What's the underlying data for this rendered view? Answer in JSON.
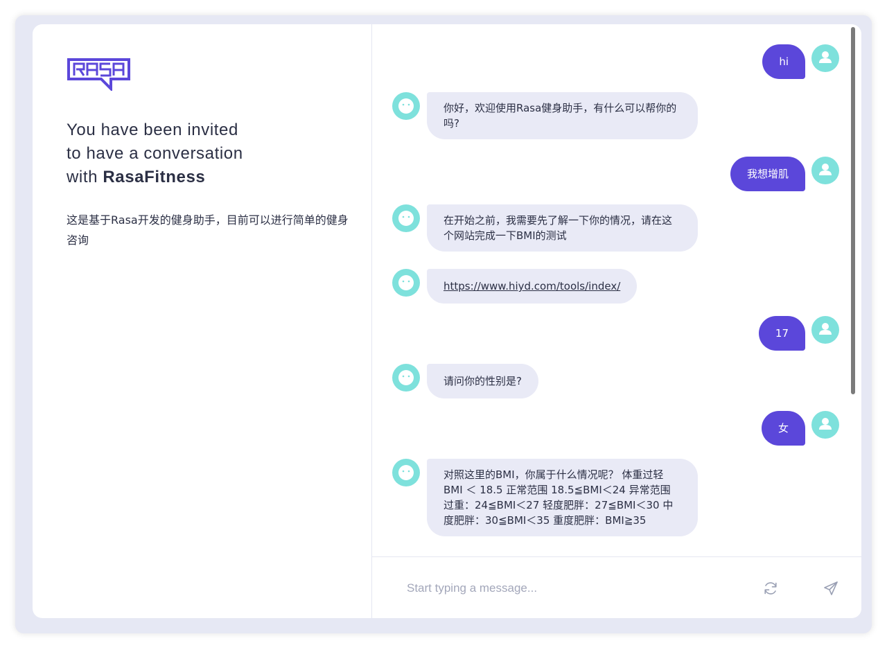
{
  "brand": {
    "logo_text": "RASA",
    "accent_color": "#5b47da",
    "avatar_color": "#7ee1dc"
  },
  "intro": {
    "line1": "You have been invited",
    "line2": "to have a conversation",
    "line3_prefix": "with ",
    "bot_name": "RasaFitness",
    "description": "这是基于Rasa开发的健身助手，目前可以进行简单的健身咨询"
  },
  "messages": [
    {
      "sender": "user",
      "text": "hi"
    },
    {
      "sender": "bot",
      "text": "你好，欢迎使用Rasa健身助手，有什么可以帮你的吗?"
    },
    {
      "sender": "user",
      "text": "我想增肌"
    },
    {
      "sender": "bot",
      "text": "在开始之前，我需要先了解一下你的情况，请在这个网站完成一下BMI的测试"
    },
    {
      "sender": "bot",
      "text": "https://www.hiyd.com/tools/index/",
      "is_link": true
    },
    {
      "sender": "user",
      "text": "17"
    },
    {
      "sender": "bot",
      "text": "请问你的性别是?"
    },
    {
      "sender": "user",
      "text": "女"
    },
    {
      "sender": "bot",
      "text": "对照这里的BMI，你属于什么情况呢？ 体重过轻 BMI ＜ 18.5 正常范围 18.5≦BMI＜24 异常范围 过重：24≦BMI＜27 轻度肥胖：27≦BMI＜30 中度肥胖：30≦BMI＜35 重度肥胖：BMI≧35"
    }
  ],
  "composer": {
    "placeholder": "Start typing a message...",
    "restart_icon": "refresh-icon",
    "send_icon": "send-icon"
  }
}
